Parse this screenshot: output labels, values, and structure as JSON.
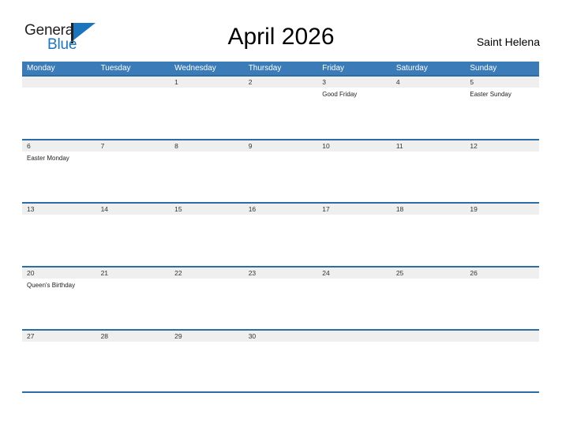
{
  "brand": {
    "word_one": "General",
    "word_two": "Blue"
  },
  "header": {
    "title": "April 2026",
    "country": "Saint Helena"
  },
  "calendar": {
    "weekdays": [
      "Monday",
      "Tuesday",
      "Wednesday",
      "Thursday",
      "Friday",
      "Saturday",
      "Sunday"
    ],
    "weeks": [
      [
        {
          "date": "",
          "events": []
        },
        {
          "date": "",
          "events": []
        },
        {
          "date": "1",
          "events": []
        },
        {
          "date": "2",
          "events": []
        },
        {
          "date": "3",
          "events": [
            "Good Friday"
          ]
        },
        {
          "date": "4",
          "events": []
        },
        {
          "date": "5",
          "events": [
            "Easter Sunday"
          ]
        }
      ],
      [
        {
          "date": "6",
          "events": [
            "Easter Monday"
          ]
        },
        {
          "date": "7",
          "events": []
        },
        {
          "date": "8",
          "events": []
        },
        {
          "date": "9",
          "events": []
        },
        {
          "date": "10",
          "events": []
        },
        {
          "date": "11",
          "events": []
        },
        {
          "date": "12",
          "events": []
        }
      ],
      [
        {
          "date": "13",
          "events": []
        },
        {
          "date": "14",
          "events": []
        },
        {
          "date": "15",
          "events": []
        },
        {
          "date": "16",
          "events": []
        },
        {
          "date": "17",
          "events": []
        },
        {
          "date": "18",
          "events": []
        },
        {
          "date": "19",
          "events": []
        }
      ],
      [
        {
          "date": "20",
          "events": [
            "Queen's Birthday"
          ]
        },
        {
          "date": "21",
          "events": []
        },
        {
          "date": "22",
          "events": []
        },
        {
          "date": "23",
          "events": []
        },
        {
          "date": "24",
          "events": []
        },
        {
          "date": "25",
          "events": []
        },
        {
          "date": "26",
          "events": []
        }
      ],
      [
        {
          "date": "27",
          "events": []
        },
        {
          "date": "28",
          "events": []
        },
        {
          "date": "29",
          "events": []
        },
        {
          "date": "30",
          "events": []
        },
        {
          "date": "",
          "events": []
        },
        {
          "date": "",
          "events": []
        },
        {
          "date": "",
          "events": []
        }
      ]
    ]
  },
  "colors": {
    "header_blue": "#3b7cb8",
    "row_rule_blue": "#2e6da4",
    "date_band_gray": "#efefef",
    "brand_blue": "#1b75bc",
    "brand_dark": "#231f20"
  }
}
